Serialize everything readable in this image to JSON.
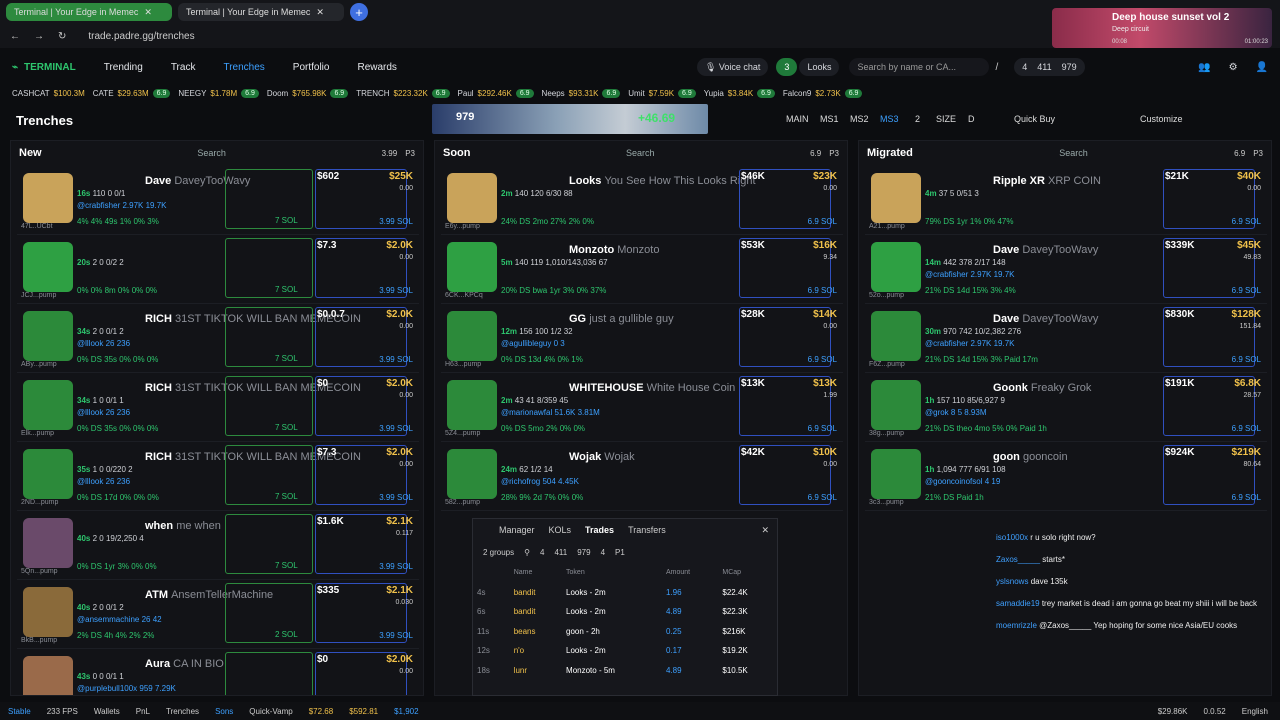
{
  "browser": {
    "tabs": [
      {
        "title": "Terminal | Your Edge in Memec"
      },
      {
        "title": "Terminal | Your Edge in Memec"
      }
    ],
    "url": "trade.padre.gg/trenches"
  },
  "media": {
    "title": "Deep house sunset vol 2",
    "artist": "Deep circuit",
    "elapsed": "00:08",
    "total": "01:00:23"
  },
  "nav": {
    "logo": "TERMINAL",
    "links": [
      "Trending",
      "Track",
      "Trenches",
      "Portfolio",
      "Rewards"
    ],
    "voice": "Voice chat",
    "looks_count": "3",
    "looks": "Looks",
    "search_placeholder": "Search by name or CA...",
    "shortcut": "/",
    "stats": [
      "4",
      "411",
      "979"
    ]
  },
  "ticker": [
    {
      "n": "CASHCAT",
      "v": "$100.3M"
    },
    {
      "n": "CATE",
      "v": "$29.63M",
      "p": "6.9"
    },
    {
      "n": "NEEGY",
      "v": "$1.78M",
      "p": "6.9"
    },
    {
      "n": "Doom",
      "v": "$765.98K",
      "p": "6.9"
    },
    {
      "n": "TRENCH",
      "v": "$223.32K",
      "p": "6.9"
    },
    {
      "n": "Paul",
      "v": "$292.46K",
      "p": "6.9"
    },
    {
      "n": "Neeps",
      "v": "$93.31K",
      "p": "6.9"
    },
    {
      "n": "Umit",
      "v": "$7.59K",
      "p": "6.9"
    },
    {
      "n": "Yupia",
      "v": "$3.84K",
      "p": "6.9"
    },
    {
      "n": "Falcon9",
      "v": "$2.73K",
      "p": "6.9"
    }
  ],
  "sub": {
    "title": "Trenches",
    "banner_left": "979",
    "banner_right": "+46.69",
    "modes": [
      "MAIN",
      "MS1",
      "MS2",
      "MS3",
      "2",
      "SIZE",
      "D"
    ],
    "quickbuy": "Quick Buy",
    "customize": "Customize"
  },
  "panels": [
    {
      "title": "New",
      "search": "Search",
      "meta": [
        "3.99",
        "P3"
      ],
      "cards": [
        {
          "name": "Dave",
          "full": "DaveyTooWavy",
          "age": "16s",
          "row2": "110  0  0/1",
          "row3": "@crabfisher 2.97K 19.7K",
          "row4": "4%  4% 49s  1%  0%  3%",
          "label": "47L..UCbt",
          "vol": "$602",
          "mc": "$25K",
          "f": "0.00",
          "buy": "3.99 SOL",
          "sol": "7 SOL"
        },
        {
          "name": "",
          "full": "",
          "age": "20s",
          "row2": "2  0  0/2  2",
          "row3": "",
          "row4": "0%  0% 8m  0%  0%  0%",
          "label": "JCJ...pump",
          "vol": "$7.3",
          "mc": "$2.0K",
          "f": "0.00",
          "buy": "3.99 SOL",
          "sol": "7 SOL"
        },
        {
          "name": "RICH",
          "full": "31ST TIKTOK WILL BAN MEMECOIN",
          "age": "34s",
          "row2": "2  0  0/1  2",
          "row3": "@lllook 26 236",
          "row4": "0%  DS 35s  0%  0%  0%",
          "label": "ABy...pump",
          "vol": "$0.0.7",
          "mc": "$2.0K",
          "f": "0.00",
          "buy": "3.99 SOL",
          "sol": "7 SOL"
        },
        {
          "name": "RICH",
          "full": "31ST TIKTOK WILL BAN MEMECOIN",
          "age": "34s",
          "row2": "1  0  0/1  1",
          "row3": "@lllook 26 236",
          "row4": "0%  DS 35s  0%  0%  0%",
          "label": "Elk...pump",
          "vol": "$0",
          "mc": "$2.0K",
          "f": "0.00",
          "buy": "3.99 SOL",
          "sol": "7 SOL"
        },
        {
          "name": "RICH",
          "full": "31ST TIKTOK WILL BAN MEMECOIN",
          "age": "35s",
          "row2": "1  0  0/220  2",
          "row3": "@lllook 26 236",
          "row4": "0%  DS 17d  0%  0%  0%",
          "label": "2ND...pump",
          "vol": "$7.3",
          "mc": "$2.0K",
          "f": "0.00",
          "buy": "3.99 SOL",
          "sol": "7 SOL"
        },
        {
          "name": "when",
          "full": "me when",
          "age": "40s",
          "row2": "2  0  19/2,250  4",
          "row3": "",
          "row4": "0%  DS 1yr  3%  0%  0%",
          "label": "5Qn...pump",
          "vol": "$1.6K",
          "mc": "$2.1K",
          "f": "0.117",
          "buy": "3.99 SOL",
          "sol": "7 SOL"
        },
        {
          "name": "ATM",
          "full": "AnsemTellerMachine",
          "age": "40s",
          "row2": "2  0  0/1  2",
          "row3": "@ansemmachine 26 42",
          "row4": "2%  DS 4h  4%  2%  2%",
          "label": "BkB...pump",
          "vol": "$335",
          "mc": "$2.1K",
          "f": "0.030",
          "buy": "3.99 SOL",
          "sol": "2 SOL"
        },
        {
          "name": "Aura",
          "full": "CA IN BIO",
          "age": "43s",
          "row2": "0  0  0/1  1",
          "row3": "@purplebull100x 959 7.29K",
          "row4": "",
          "label": "",
          "vol": "$0",
          "mc": "$2.0K",
          "f": "0.00",
          "buy": "",
          "sol": ""
        }
      ]
    },
    {
      "title": "Soon",
      "search": "Search",
      "meta": [
        "6.9",
        "P3"
      ],
      "cards": [
        {
          "name": "Looks",
          "full": "You See How This Looks Right",
          "age": "2m",
          "row2": "140  120  6/30  88",
          "row3": "",
          "row4": "24%  DS 2mo  27%  2%  0%",
          "label": "E6y...pump",
          "vol": "$46K",
          "mc": "$23K",
          "f": "0.00",
          "buy": "6.9 SOL",
          "sol": ""
        },
        {
          "name": "Monzoto",
          "full": "Monzoto",
          "age": "5m",
          "row2": "140  119  1,010/143,036  67",
          "row3": "",
          "row4": "20%  DS bwa 1yr  3%  0%  37%",
          "label": "6CK...KPCq",
          "vol": "$53K",
          "mc": "$16K",
          "f": "9.34",
          "buy": "6.9 SOL",
          "sol": ""
        },
        {
          "name": "GG",
          "full": "just a gullible guy",
          "age": "12m",
          "row2": "156  100  1/2  32",
          "row3": "@agullibleguy 0 3",
          "row4": "0%  DS 13d  4%  0%  1%",
          "label": "H63...pump",
          "vol": "$28K",
          "mc": "$14K",
          "f": "0.00",
          "buy": "6.9 SOL",
          "sol": ""
        },
        {
          "name": "WHITEHOUSE",
          "full": "White House Coin",
          "age": "2m",
          "row2": "43  41  8/359  45",
          "row3": "@marionawfal 51.6K 3.81M",
          "row4": "0%  DS 5mo  2%  0%  0%",
          "label": "5Z4...pump",
          "vol": "$13K",
          "mc": "$13K",
          "f": "1.99",
          "buy": "6.9 SOL",
          "sol": ""
        },
        {
          "name": "Wojak",
          "full": "Wojak",
          "age": "24m",
          "row2": "62  1/2  14",
          "row3": "@richofrog 504 4.45K",
          "row4": "28%  9% 2d  7%  0%  0%",
          "label": "582...pump",
          "vol": "$42K",
          "mc": "$10K",
          "f": "0.00",
          "buy": "6.9 SOL",
          "sol": ""
        }
      ]
    },
    {
      "title": "Migrated",
      "search": "Search",
      "meta": [
        "6.9",
        "P3"
      ],
      "cards": [
        {
          "name": "Ripple XR",
          "full": "XRP COIN",
          "age": "4m",
          "row2": "37  5  0/51  3",
          "row3": "",
          "row4": "79%  DS 1yr  1%  0%  47%",
          "label": "A21...pump",
          "vol": "$21K",
          "mc": "$40K",
          "f": "0.00",
          "buy": "6.9 SOL",
          "sol": ""
        },
        {
          "name": "Dave",
          "full": "DaveyTooWavy",
          "age": "14m",
          "row2": "442  378  2/17  148",
          "row3": "@crabfisher 2.97K 19.7K",
          "row4": "21%  DS 14d  15%  3%  4%",
          "label": "52o...pump",
          "vol": "$339K",
          "mc": "$45K",
          "f": "49.83",
          "buy": "6.9 SOL",
          "sol": ""
        },
        {
          "name": "Dave",
          "full": "DaveyTooWavy",
          "age": "30m",
          "row2": "970  742  10/2,382  276",
          "row3": "@crabfisher 2.97K 19.7K",
          "row4": "21%  DS 14d  15%  3%  Paid 17m",
          "label": "F6Z...pump",
          "vol": "$830K",
          "mc": "$128K",
          "f": "151.84",
          "buy": "6.9 SOL",
          "sol": ""
        },
        {
          "name": "Goonk",
          "full": "Freaky Grok",
          "age": "1h",
          "row2": "157  110  85/6,927  9",
          "row3": "@grok 8 5 8.93M",
          "row4": "21%  DS theo 4mo  5%  0%  Paid 1h",
          "label": "38g...pump",
          "vol": "$191K",
          "mc": "$6.8K",
          "f": "28.57",
          "buy": "6.9 SOL",
          "sol": ""
        },
        {
          "name": "goon",
          "full": "gooncoin",
          "age": "1h",
          "row2": "1,094  777  6/91  108",
          "row3": "@gooncoinofsol 4 19",
          "row4": "21%  DS  Paid 1h",
          "label": "3c3...pump",
          "vol": "$924K",
          "mc": "$219K",
          "f": "80.64",
          "buy": "6.9 SOL",
          "sol": ""
        }
      ]
    }
  ],
  "trades": {
    "tabs": [
      "Manager",
      "KOLs",
      "Trades",
      "Transfers"
    ],
    "groups": "2 groups",
    "stats": [
      "4",
      "411",
      "979",
      "4",
      "P1"
    ],
    "cols": [
      "Name",
      "Token",
      "Amount",
      "MCap"
    ],
    "rows": [
      [
        "4s",
        "bandit",
        "Looks - 2m",
        "1.96",
        "$22.4K"
      ],
      [
        "6s",
        "bandit",
        "Looks - 2m",
        "4.89",
        "$22.3K"
      ],
      [
        "11s",
        "beans",
        "goon - 2h",
        "0.25",
        "$216K"
      ],
      [
        "12s",
        "n'o",
        "Looks - 2m",
        "0.17",
        "$19.2K"
      ],
      [
        "18s",
        "lunr",
        "Monzoto - 5m",
        "4.89",
        "$10.5K"
      ]
    ]
  },
  "chat": [
    {
      "u": "iso1000x",
      "m": "r u solo right now?"
    },
    {
      "u": "Zaxos_____",
      "m": "starts*"
    },
    {
      "u": "yslsnows",
      "m": "dave 135k"
    },
    {
      "u": "samaddie19",
      "m": "trey market is dead i am gonna go beat my shiii i will be back"
    },
    {
      "u": "moemrizzle",
      "m": "@Zaxos_____ Yep hoping for some nice Asia/EU cooks"
    }
  ],
  "footer": {
    "stable": "Stable",
    "fps": "233 FPS",
    "wallets": "Wallets",
    "pnl": "PnL",
    "trenches": "Trenches",
    "sons": "Sons",
    "quickvamp": "Quick-Vamp",
    "p1": "$72.68",
    "p2": "$592.81",
    "p3": "$1,902",
    "right1": "$29.86K",
    "right2": "0.0.52",
    "lang": "English"
  }
}
